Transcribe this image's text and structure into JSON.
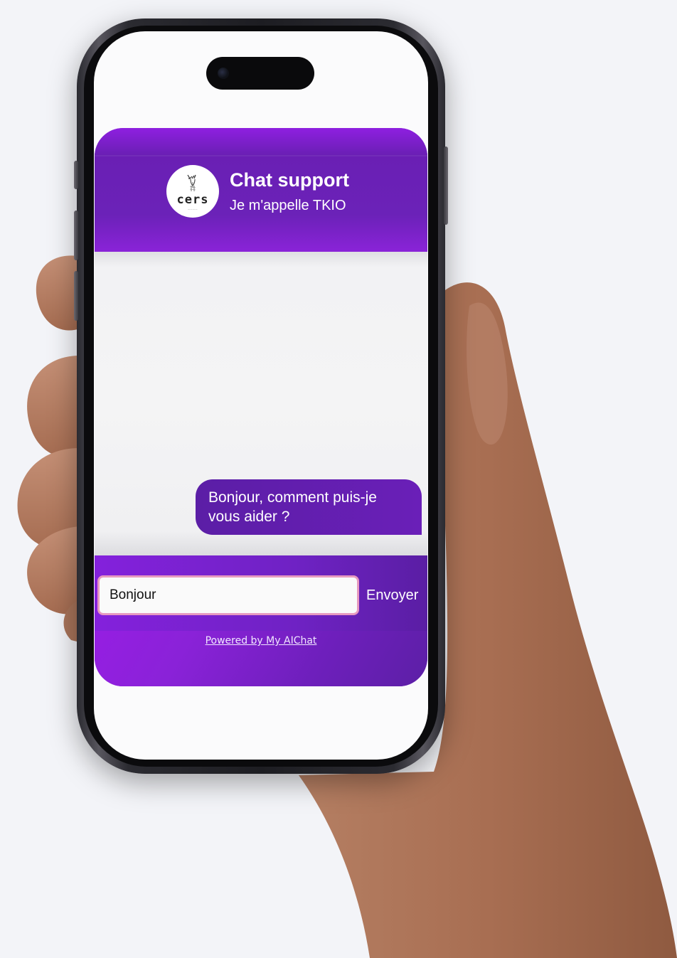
{
  "theme": {
    "accent": "#7b1fd6",
    "accent_dark": "#5b1ea6",
    "input_border": "#e79ac0"
  },
  "header": {
    "logo_text": "cers",
    "logo_icon": "cers-logo-icon",
    "title": "Chat support",
    "subtitle": "Je m'appelle TKIO"
  },
  "messages": [
    {
      "from": "bot",
      "text": "Bonjour, comment puis-je vous aider ?"
    }
  ],
  "composer": {
    "value": "Bonjour",
    "send_label": "Envoyer"
  },
  "footer": {
    "powered_by": "Powered by My AIChat"
  }
}
